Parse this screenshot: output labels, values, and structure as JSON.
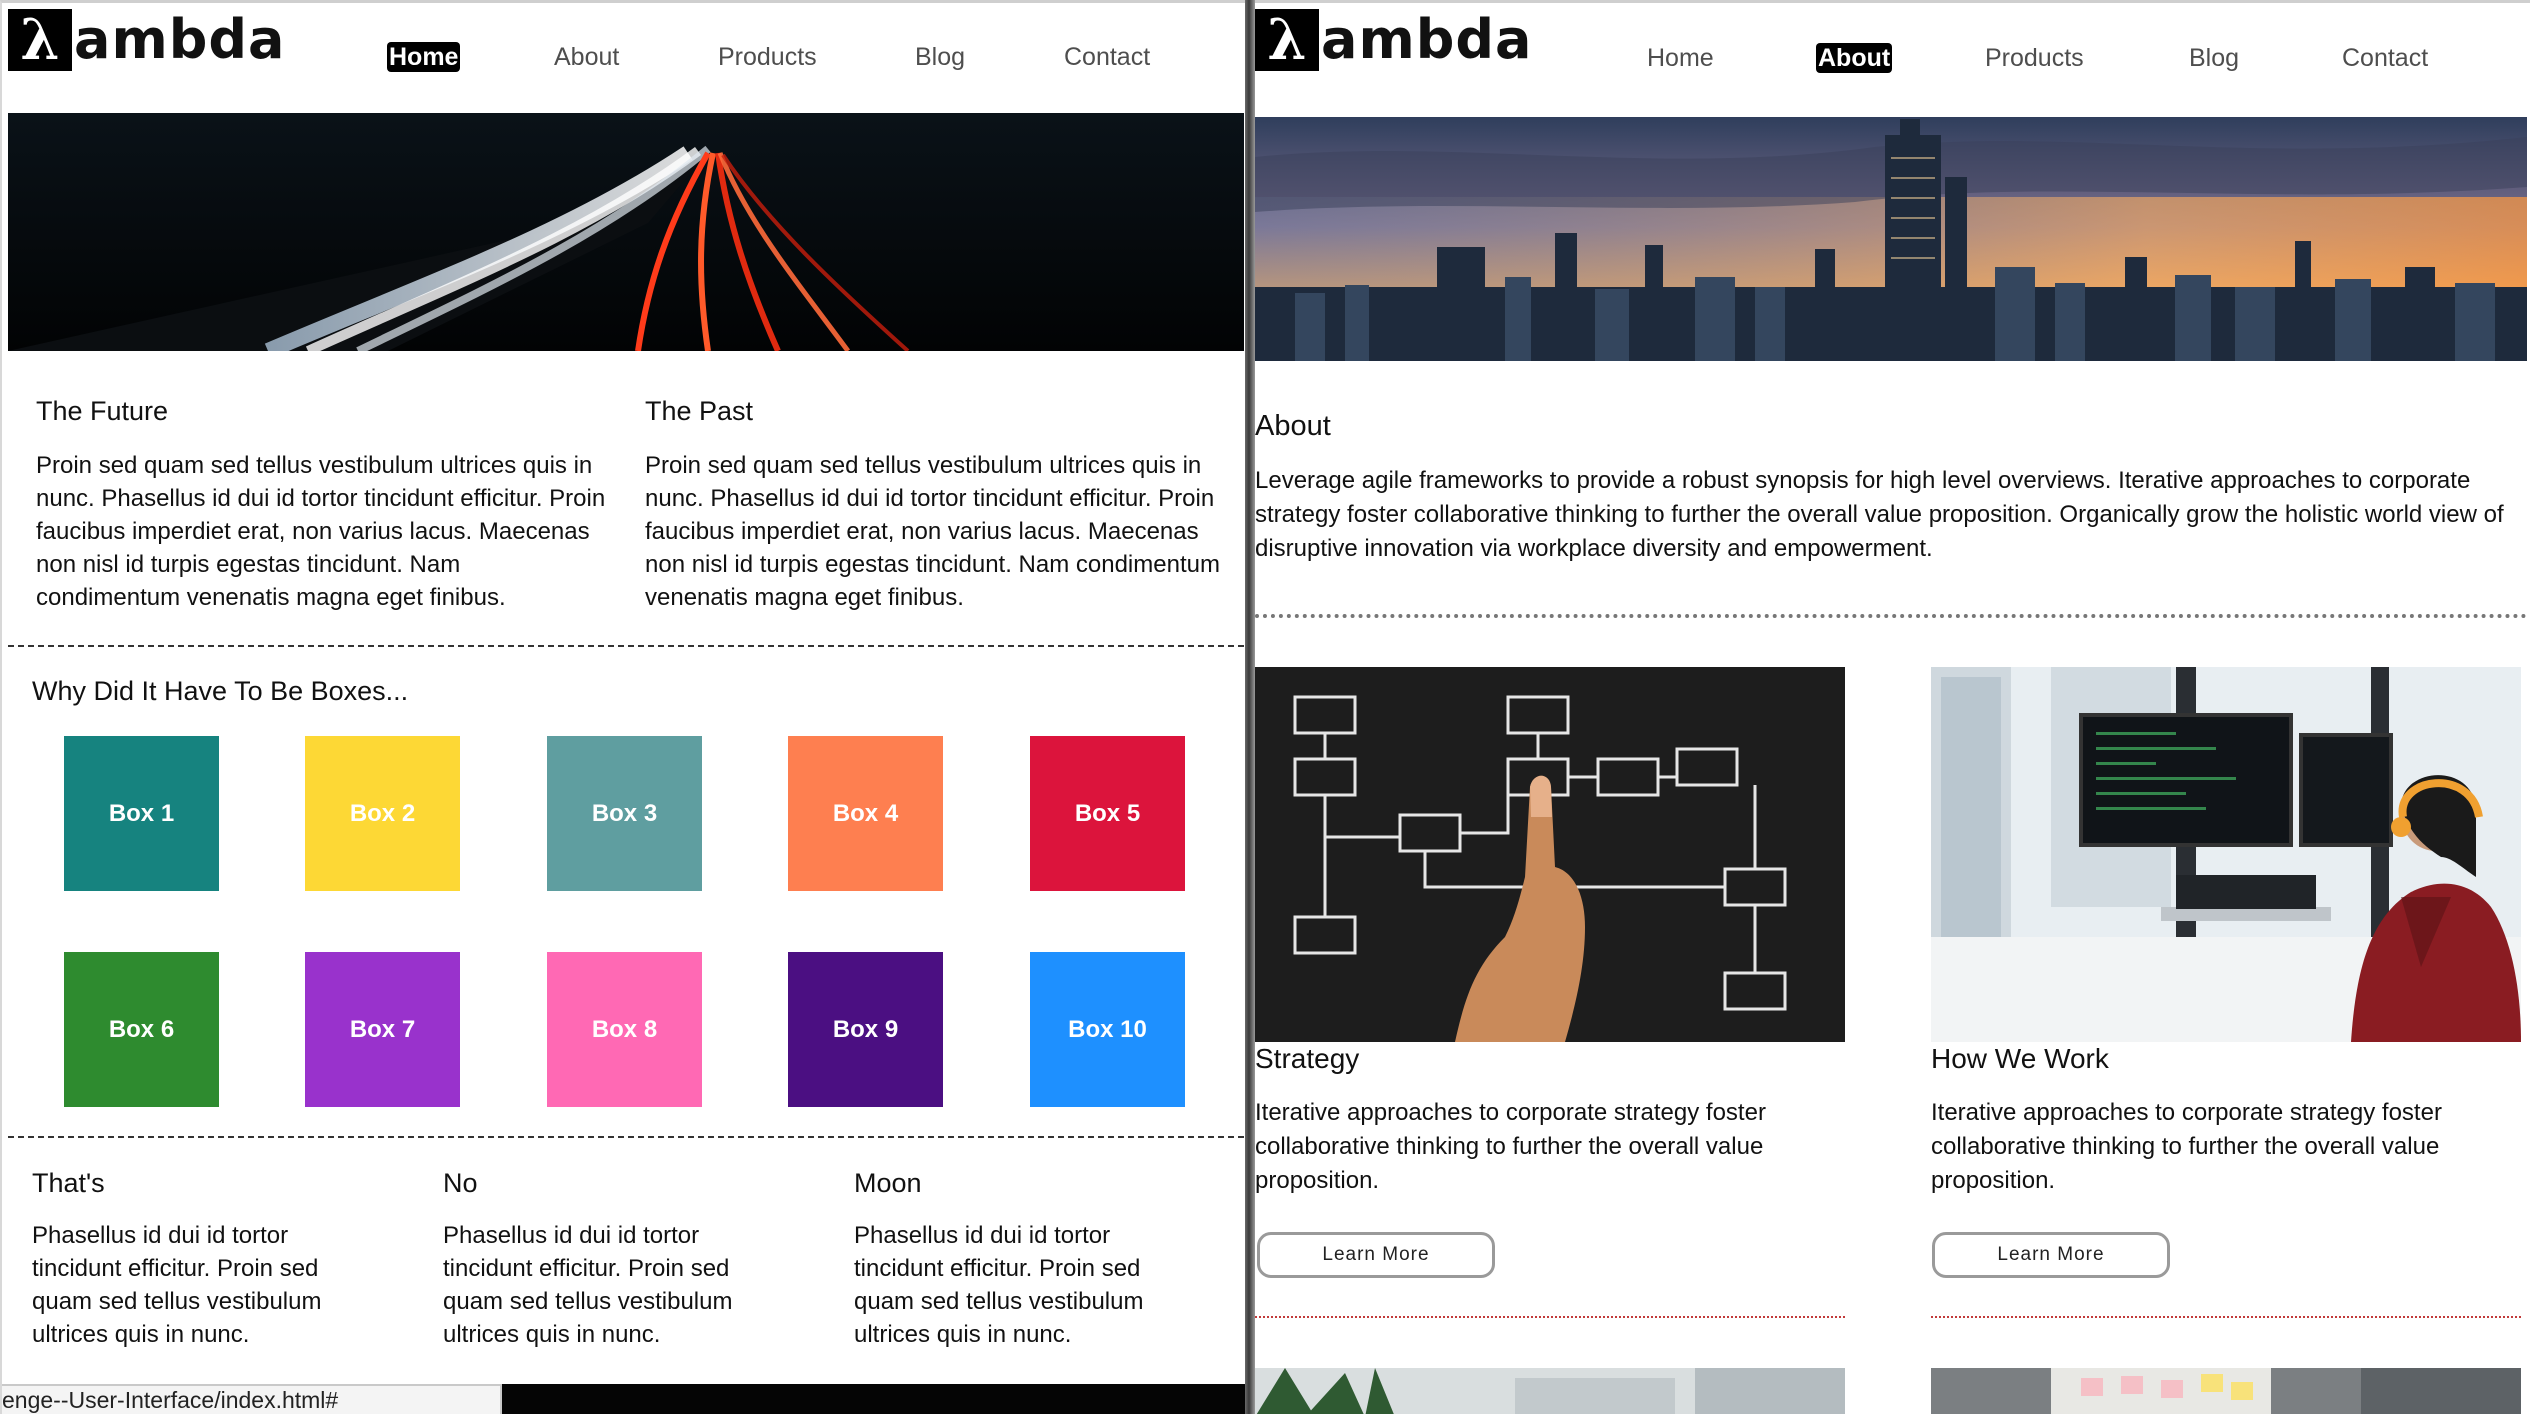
{
  "left": {
    "logo_lambda": "λ",
    "logo_text": "ambda",
    "nav": [
      "Home",
      "About",
      "Products",
      "Blog",
      "Contact"
    ],
    "columns": [
      {
        "title": "The Future",
        "text": "Proin sed quam sed tellus vestibulum ultrices quis in nunc. Phasellus id dui id tortor tincidunt efficitur. Proin faucibus imperdiet erat, non varius lacus. Maecenas non nisl id turpis egestas tincidunt. Nam condimentum venenatis magna eget finibus."
      },
      {
        "title": "The Past",
        "text": "Proin sed quam sed tellus vestibulum ultrices quis in nunc. Phasellus id dui id tortor tincidunt efficitur. Proin faucibus imperdiet erat, non varius lacus. Maecenas non nisl id turpis egestas tincidunt. Nam condimentum venenatis magna eget finibus."
      }
    ],
    "boxes_heading": "Why Did It Have To Be Boxes...",
    "boxes": [
      {
        "label": "Box 1",
        "color": "#16837f"
      },
      {
        "label": "Box 2",
        "color": "#fdd835"
      },
      {
        "label": "Box 3",
        "color": "#5f9ea0"
      },
      {
        "label": "Box 4",
        "color": "#fe7f50"
      },
      {
        "label": "Box 5",
        "color": "#dc143c"
      },
      {
        "label": "Box 6",
        "color": "#2e8b2f"
      },
      {
        "label": "Box 7",
        "color": "#9932cc"
      },
      {
        "label": "Box 8",
        "color": "#ff69b4"
      },
      {
        "label": "Box 9",
        "color": "#4b0f82"
      },
      {
        "label": "Box 10",
        "color": "#1e90ff"
      }
    ],
    "bottom_columns": [
      {
        "title": "That's",
        "text": "Phasellus id dui id tortor tincidunt efficitur. Proin sed quam sed tellus vestibulum ultrices quis in nunc."
      },
      {
        "title": "No",
        "text": "Phasellus id dui id tortor tincidunt efficitur. Proin sed quam sed tellus vestibulum ultrices quis in nunc."
      },
      {
        "title": "Moon",
        "text": "Phasellus id dui id tortor tincidunt efficitur. Proin sed quam sed tellus vestibulum ultrices quis in nunc."
      }
    ],
    "status_url": "enge--User-Interface/index.html#"
  },
  "right": {
    "logo_lambda": "λ",
    "logo_text": "ambda",
    "nav": [
      "Home",
      "About",
      "Products",
      "Blog",
      "Contact"
    ],
    "about_title": "About",
    "about_text": "Leverage agile frameworks to provide a robust synopsis for high level overviews. Iterative approaches to corporate strategy foster collaborative thinking to further the overall value proposition. Organically grow the holistic world view of disruptive innovation via workplace diversity and empowerment.",
    "cards": [
      {
        "title": "Strategy",
        "text": "Iterative approaches to corporate strategy foster collaborative thinking to further the overall value proposition.",
        "button": "Learn More"
      },
      {
        "title": "How We Work",
        "text": "Iterative approaches to corporate strategy foster collaborative thinking to further the overall value proposition.",
        "button": "Learn More"
      }
    ]
  }
}
